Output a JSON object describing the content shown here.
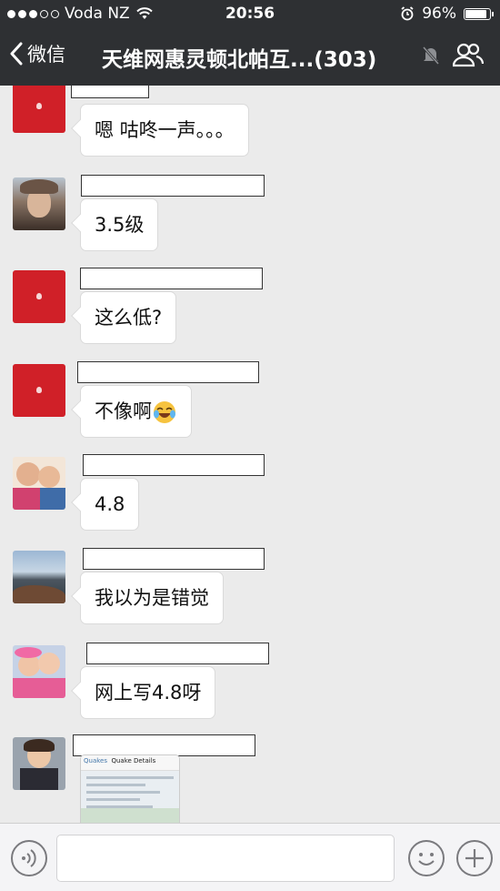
{
  "status_bar": {
    "carrier": "Voda NZ",
    "time": "20:56",
    "battery": "96%",
    "battery_level": 0.96
  },
  "nav": {
    "back_label": "微信",
    "title": "天维网惠灵顿北帕互...(303)"
  },
  "messages": [
    {
      "text": "嗯 咕咚一声。。。"
    },
    {
      "text": "3.5级"
    },
    {
      "text": "这么低?"
    },
    {
      "text": "不像啊"
    },
    {
      "text": "4.8"
    },
    {
      "text": "我以为是错觉"
    },
    {
      "text": "网上写4.8呀"
    },
    {
      "text": ""
    }
  ],
  "thumbnail": {
    "tab_back": "Quakes",
    "tab_title": "Quake Details"
  },
  "colors": {
    "bar": "#2e3033",
    "background": "#ebebeb",
    "avatar_red": "#d02028"
  }
}
